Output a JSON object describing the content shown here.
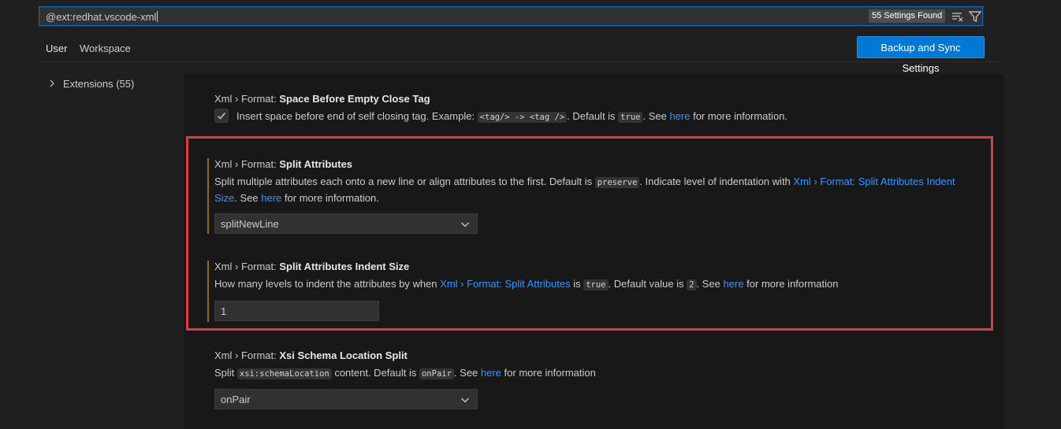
{
  "search": {
    "value": "@ext:redhat.vscode-xml",
    "count": "55 Settings Found",
    "clear_icon": "clear-filter-icon",
    "filter_icon": "filter-icon"
  },
  "tabs": [
    {
      "label": "User",
      "active": true
    },
    {
      "label": "Workspace",
      "active": false
    }
  ],
  "sync_button": "Backup and Sync Settings",
  "tree": {
    "item_label": "Extensions (55)",
    "icon": "chevron-right-icon"
  },
  "settings": {
    "space_before_empty_close_tag": {
      "category": "Xml › Format: ",
      "name": "Space Before Empty Close Tag",
      "checked": true,
      "desc": {
        "t1": "Insert space before end of self closing tag. Example: ",
        "code1": "<tag/> -> <tag />",
        "t2": ". Default is ",
        "code2": "true",
        "t3": ". See ",
        "link": "here",
        "t4": " for more information."
      }
    },
    "split_attributes": {
      "category": "Xml › Format: ",
      "name": "Split Attributes",
      "desc": {
        "t1": "Split multiple attributes each onto a new line or align attributes to the first. Default is ",
        "code1": "preserve",
        "t2": ". Indicate level of indentation with ",
        "link1": "Xml › Format: Split Attributes Indent Size",
        "t3": ". See ",
        "link2": "here",
        "t4": " for more information."
      },
      "value": "splitNewLine"
    },
    "split_attributes_indent_size": {
      "category": "Xml › Format: ",
      "name": "Split Attributes Indent Size",
      "desc": {
        "t1": "How many levels to indent the attributes by when ",
        "link1": "Xml › Format: Split Attributes",
        "t2": " is ",
        "code1": "true",
        "t3": ". Default value is ",
        "code2": "2",
        "t4": ". See ",
        "link2": "here",
        "t5": " for more information"
      },
      "value": "1"
    },
    "xsi_schema_location_split": {
      "category": "Xml › Format: ",
      "name": "Xsi Schema Location Split",
      "desc": {
        "t1": "Split ",
        "code1": "xsi:schemaLocation",
        "t2": " content. Default is ",
        "code2": "onPair",
        "t3": ". See ",
        "link": "here",
        "t4": " for more information"
      },
      "value": "onPair"
    }
  },
  "colors": {
    "accent": "#0078d4",
    "link": "#3794ff",
    "highlight_border": "#e0393e",
    "modified_indicator": "#8c6a1f"
  }
}
